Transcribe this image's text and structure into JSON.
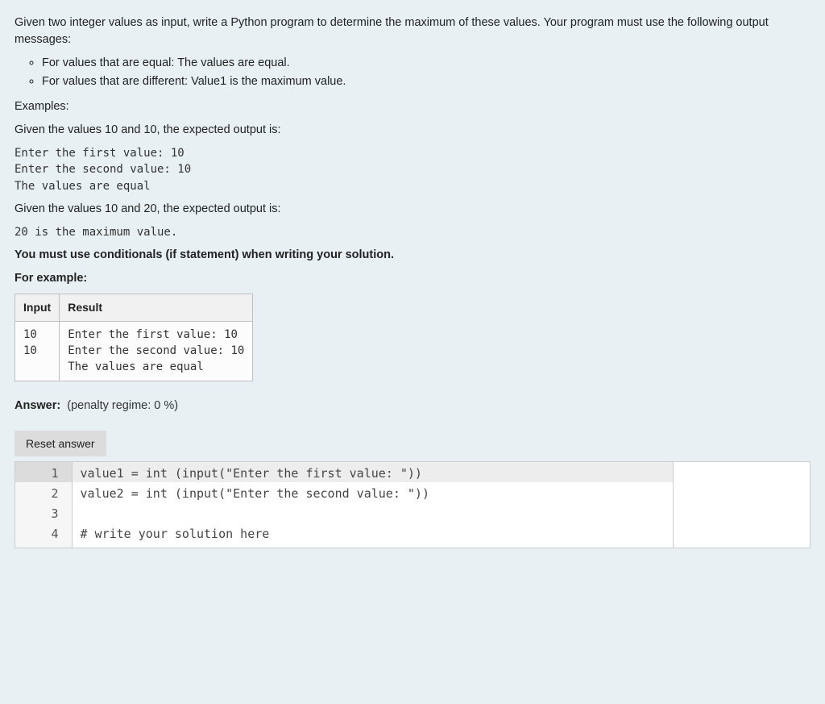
{
  "intro": "Given two integer values as input, write a Python program to determine the maximum of these values. Your program must use the following output messages:",
  "bullets": [
    "For values that are equal: The values are equal.",
    "For values that are different: Value1 is the maximum value."
  ],
  "examples_label": "Examples:",
  "example1_intro": "Given the values 10 and 10, the expected output is:",
  "example1_out": "Enter the first value: 10\nEnter the second value: 10\nThe values are equal",
  "example2_intro": "Given the values 10 and 20, the expected output is:",
  "example2_out": "20 is the maximum value.",
  "constraint": "You must use conditionals (if statement) when writing your solution.",
  "for_example_label": "For example:",
  "table": {
    "headers": {
      "input": "Input",
      "result": "Result"
    },
    "row": {
      "input": "10\n10",
      "result": "Enter the first value: 10\nEnter the second value: 10\nThe values are equal"
    }
  },
  "answer_label": "Answer:",
  "answer_meta": "(penalty regime: 0 %)",
  "reset_label": "Reset answer",
  "code_lines": [
    {
      "n": "1",
      "text": "value1 = int (input(\"Enter the first value: \"))"
    },
    {
      "n": "2",
      "text": "value2 = int (input(\"Enter the second value: \"))"
    },
    {
      "n": "3",
      "text": ""
    },
    {
      "n": "4",
      "text": "# write your solution here"
    }
  ],
  "active_line_index": 0
}
